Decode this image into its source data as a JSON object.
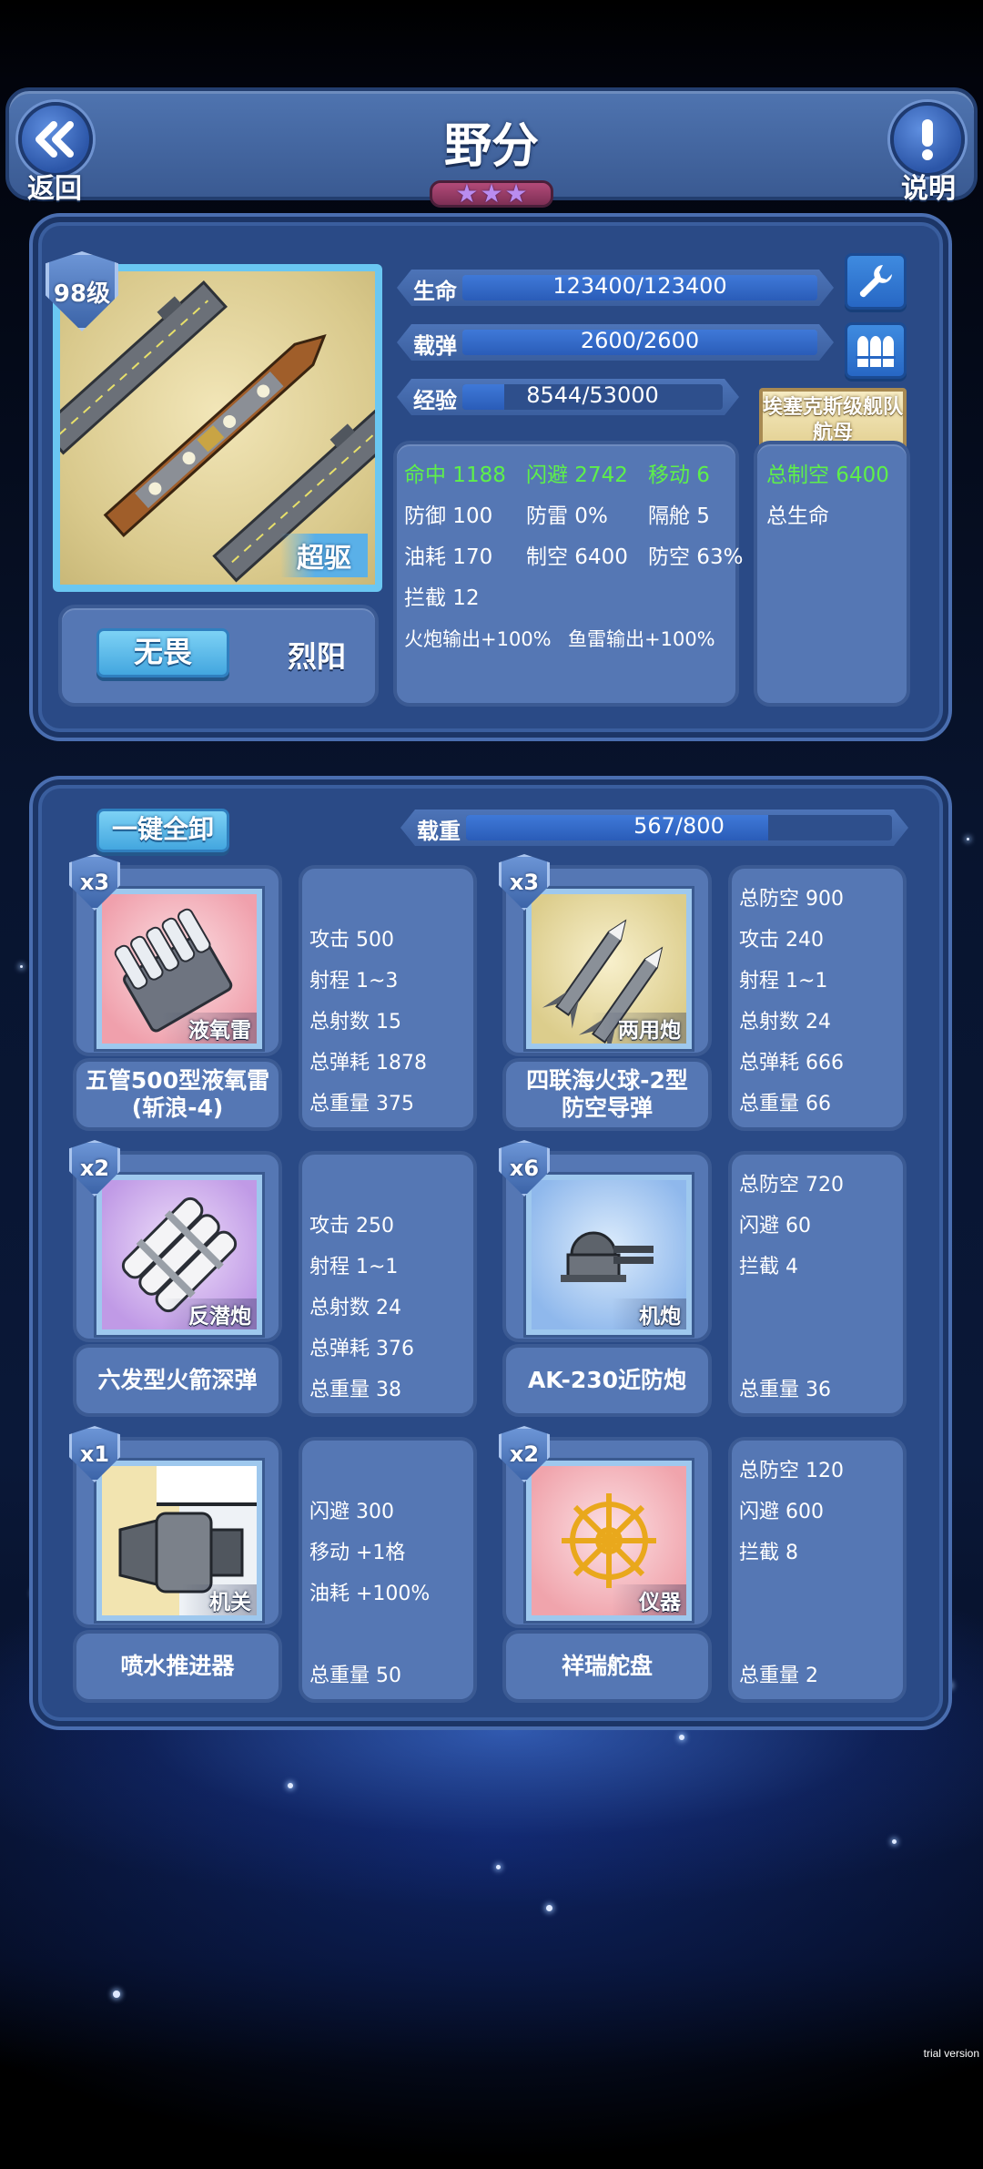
{
  "header": {
    "title": "野分",
    "back_label": "返回",
    "help_label": "说明",
    "star_count": 3
  },
  "ship": {
    "level": "98级",
    "class_tag": "超驱",
    "type": "埃塞克斯级舰队航母",
    "skill_button": "无畏",
    "skill_name": "烈阳",
    "hp": {
      "label": "生命",
      "value": "123400/123400",
      "fraction": 1.0
    },
    "ammo": {
      "label": "载弹",
      "value": "2600/2600",
      "fraction": 1.0
    },
    "exp": {
      "label": "经验",
      "value": "8544/53000",
      "fraction": 0.161
    },
    "stats": {
      "hit": "命中 1188",
      "evasion": "闪避 2742",
      "move": "移动 6",
      "defense": "防御 100",
      "torpedo_def": "防雷 0%",
      "bulkhead": "隔舱 5",
      "fuel": "油耗 170",
      "air_control": "制空 6400",
      "anti_air": "防空 63%",
      "intercept": "拦截 12",
      "gun_output": "火炮输出+100%",
      "torpedo_output": "鱼雷输出+100%"
    },
    "totals": {
      "total_air": "总制空 6400",
      "total_hp": "总生命"
    }
  },
  "equipment": {
    "unload_all": "一键全卸",
    "load": {
      "label": "载重",
      "value": "567/800",
      "fraction": 0.709
    },
    "items": [
      {
        "count": "x3",
        "tag": "液氧雷",
        "name": "五管500型液氧雷\n(斩浪-4)",
        "stats": [
          {
            "text": "攻击 500",
            "color": "white"
          },
          {
            "text": "射程 1~3",
            "color": "white"
          },
          {
            "text": "总射数 15",
            "color": "green"
          },
          {
            "text": "总弹耗 1878",
            "color": "red"
          }
        ],
        "weight": "总重量 375"
      },
      {
        "count": "x3",
        "tag": "两用炮",
        "name": "四联海火球-2型\n防空导弹",
        "stats": [
          {
            "text": "总防空 900",
            "color": "green"
          },
          {
            "text": "攻击 240",
            "color": "white"
          },
          {
            "text": "射程 1~1",
            "color": "white"
          },
          {
            "text": "总射数 24",
            "color": "green"
          },
          {
            "text": "总弹耗 666",
            "color": "red"
          }
        ],
        "weight": "总重量 66"
      },
      {
        "count": "x2",
        "tag": "反潜炮",
        "name": "六发型火箭深弹",
        "stats": [
          {
            "text": "攻击 250",
            "color": "white"
          },
          {
            "text": "射程 1~1",
            "color": "white"
          },
          {
            "text": "总射数 24",
            "color": "green"
          },
          {
            "text": "总弹耗 376",
            "color": "red"
          }
        ],
        "weight": "总重量 38"
      },
      {
        "count": "x6",
        "tag": "机炮",
        "name": "AK-230近防炮",
        "stats": [
          {
            "text": "总防空 720",
            "color": "white"
          },
          {
            "text": "闪避 60",
            "color": "white"
          },
          {
            "text": "拦截 4",
            "color": "white"
          }
        ],
        "weight": "总重量 36"
      },
      {
        "count": "x1",
        "tag": "机关",
        "name": "喷水推进器",
        "stats": [
          {
            "text": "闪避 300",
            "color": "white"
          },
          {
            "text": "移动 +1格",
            "color": "white"
          },
          {
            "text": "油耗 +100%",
            "color": "white"
          }
        ],
        "weight": "总重量 50"
      },
      {
        "count": "x2",
        "tag": "仪器",
        "name": "祥瑞舵盘",
        "stats": [
          {
            "text": "总防空 120",
            "color": "white"
          },
          {
            "text": "闪避 600",
            "color": "white"
          },
          {
            "text": "拦截 8",
            "color": "white"
          }
        ],
        "weight": "总重量 2"
      }
    ]
  },
  "watermark": "trial version",
  "colors": {
    "panel": "#2a4a86",
    "box": "#5577b4",
    "green": "#5ef04a",
    "red": "#ff3b3b",
    "accent": "#6ac7f2"
  }
}
